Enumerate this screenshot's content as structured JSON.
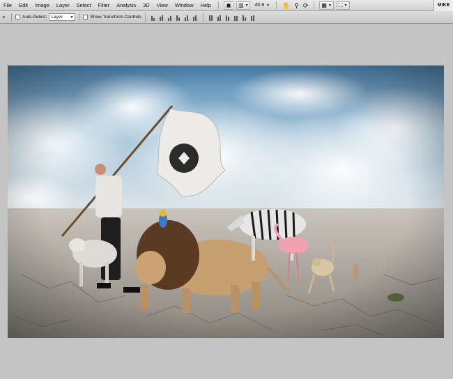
{
  "menubar": {
    "items": [
      "File",
      "Edit",
      "Image",
      "Layer",
      "Select",
      "Filter",
      "Analysis",
      "3D",
      "View",
      "Window",
      "Help"
    ],
    "zoom": "40.9",
    "workspace": "MIKE"
  },
  "options": {
    "auto_select_label": "Auto-Select:",
    "auto_select_value": "Layer",
    "show_transform_label": "Show Transform Controls"
  },
  "icons": {
    "bridge": "bridge-icon",
    "hand": "hand-tool-icon",
    "zoom": "zoom-tool-icon",
    "rotate": "rotate-view-icon",
    "arrange": "arrange-documents-icon",
    "screen_mode": "screen-mode-icon"
  },
  "canvas": {
    "sky_color": "#8fb4cb",
    "ground_color": "#a9a49c"
  }
}
